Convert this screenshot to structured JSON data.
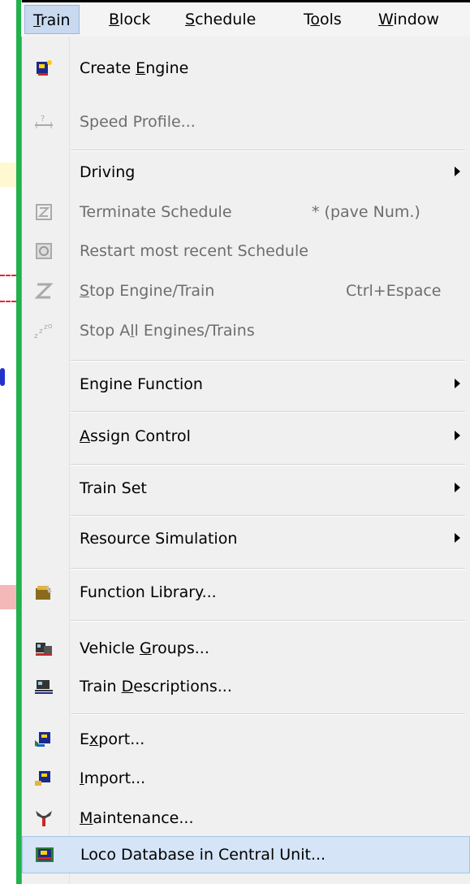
{
  "menubar": {
    "items": [
      {
        "label": "Train",
        "mnemonic": "T",
        "rest": "rain",
        "active": true
      },
      {
        "label": "Block",
        "mnemonic": "B",
        "rest": "lock"
      },
      {
        "label": "Schedule",
        "mnemonic": "S",
        "rest": "chedule"
      },
      {
        "label": "Tools",
        "pre": "T",
        "mnemonic": "o",
        "rest": "ols"
      },
      {
        "label": "Window",
        "mnemonic": "W",
        "rest": "indow"
      }
    ]
  },
  "menu": {
    "items": [
      {
        "pre": "Create ",
        "mnemonic": "E",
        "post": "ngine",
        "icon": "create-engine-icon",
        "disabled": false
      },
      {
        "pre": "Speed Profile...",
        "mnemonic": "",
        "post": "",
        "icon": "speed-profile-icon",
        "disabled": true
      },
      {
        "pre": "Driving",
        "mnemonic": "",
        "post": "",
        "icon": "",
        "submenu": true,
        "disabled": false
      },
      {
        "pre": "Terminate Schedule",
        "mnemonic": "",
        "post": "",
        "icon": "terminate-schedule-icon",
        "shortcut": "* (pave Num.)",
        "disabled": true
      },
      {
        "pre": "Restart most recent Schedule",
        "mnemonic": "",
        "post": "",
        "icon": "restart-schedule-icon",
        "disabled": true
      },
      {
        "pre": "",
        "mnemonic": "S",
        "post": "top Engine/Train",
        "icon": "stop-engine-icon",
        "shortcut": "Ctrl+Espace",
        "disabled": true
      },
      {
        "pre": "Stop A",
        "mnemonic": "l",
        "post": "l Engines/Trains",
        "icon": "stop-all-engines-icon",
        "disabled": true
      },
      {
        "pre": "Engine Function",
        "mnemonic": "",
        "post": "",
        "icon": "",
        "submenu": true,
        "disabled": false
      },
      {
        "pre": "",
        "mnemonic": "A",
        "post": "ssign Control",
        "icon": "",
        "submenu": true,
        "disabled": false
      },
      {
        "pre": "Train Set",
        "mnemonic": "",
        "post": "",
        "icon": "",
        "submenu": true,
        "disabled": false
      },
      {
        "pre": "Resource Simulation",
        "mnemonic": "",
        "post": "",
        "icon": "",
        "submenu": true,
        "disabled": false
      },
      {
        "pre": "Function Library...",
        "mnemonic": "",
        "post": "",
        "icon": "function-library-icon",
        "disabled": false
      },
      {
        "pre": "Vehicle ",
        "mnemonic": "G",
        "post": "roups...",
        "icon": "vehicle-groups-icon",
        "disabled": false
      },
      {
        "pre": "Train ",
        "mnemonic": "D",
        "post": "escriptions...",
        "icon": "train-descriptions-icon",
        "disabled": false
      },
      {
        "pre": "E",
        "mnemonic": "x",
        "post": "port...",
        "icon": "export-icon",
        "disabled": false
      },
      {
        "pre": "",
        "mnemonic": "I",
        "post": "mport...",
        "icon": "import-icon",
        "disabled": false
      },
      {
        "pre": "",
        "mnemonic": "M",
        "post": "aintenance...",
        "icon": "maintenance-icon",
        "disabled": false
      },
      {
        "pre": "Loco Database in Central Unit...",
        "mnemonic": "",
        "post": "",
        "icon": "loco-database-icon",
        "disabled": false,
        "highlighted": true
      }
    ]
  },
  "colors": {
    "menubar_active": "#c8d9f0",
    "highlight": "#d5e4f6",
    "disabled_text": "#6d6d6d",
    "green_bar": "#22b14c"
  }
}
